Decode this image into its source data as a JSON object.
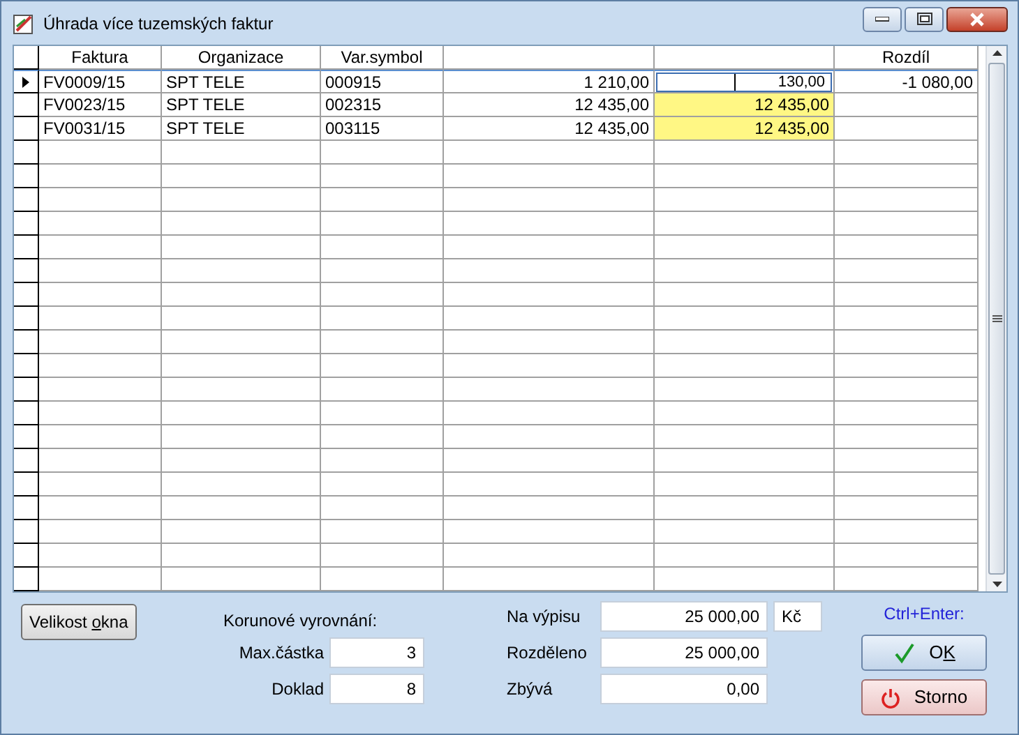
{
  "window": {
    "title": "Úhrada více tuzemských faktur"
  },
  "table": {
    "columns": [
      "Faktura",
      "Organizace",
      "Var.symbol",
      "",
      "",
      "Rozdíl"
    ],
    "rows": [
      {
        "faktura": "FV0009/15",
        "organizace": "SPT TELE",
        "var_symbol": "000915",
        "column_4": "1 210,00",
        "column_5": "130,00",
        "rozdil": "-1 080,00",
        "selected": true,
        "column_5_highlighted": false
      },
      {
        "faktura": "FV0023/15",
        "organizace": "SPT TELE",
        "var_symbol": "002315",
        "column_4": "12 435,00",
        "column_5": "12 435,00",
        "rozdil": "",
        "selected": false,
        "column_5_highlighted": true
      },
      {
        "faktura": "FV0031/15",
        "organizace": "SPT TELE",
        "var_symbol": "003115",
        "column_4": "12 435,00",
        "column_5": "12 435,00",
        "rozdil": "",
        "selected": false,
        "column_5_highlighted": true
      }
    ]
  },
  "window_size_button": {
    "label_before": "Velikost ",
    "mnemonic": "o",
    "label_after": "kna"
  },
  "rounding": {
    "heading": "Korunové vyrovnání:",
    "fields": [
      {
        "label": "Max.částka",
        "value": "3"
      },
      {
        "label": "Doklad",
        "value": "8"
      }
    ]
  },
  "totals": [
    {
      "label": "Na výpisu",
      "value": "25 000,00",
      "currency": "Kč"
    },
    {
      "label": "Rozděleno",
      "value": "25 000,00"
    },
    {
      "label": "Zbývá",
      "value": "0,00"
    }
  ],
  "shortcut_hint": "Ctrl+Enter:",
  "ok_button": {
    "label_before": "O",
    "mnemonic": "K"
  },
  "cancel_button": {
    "label": "Storno"
  }
}
